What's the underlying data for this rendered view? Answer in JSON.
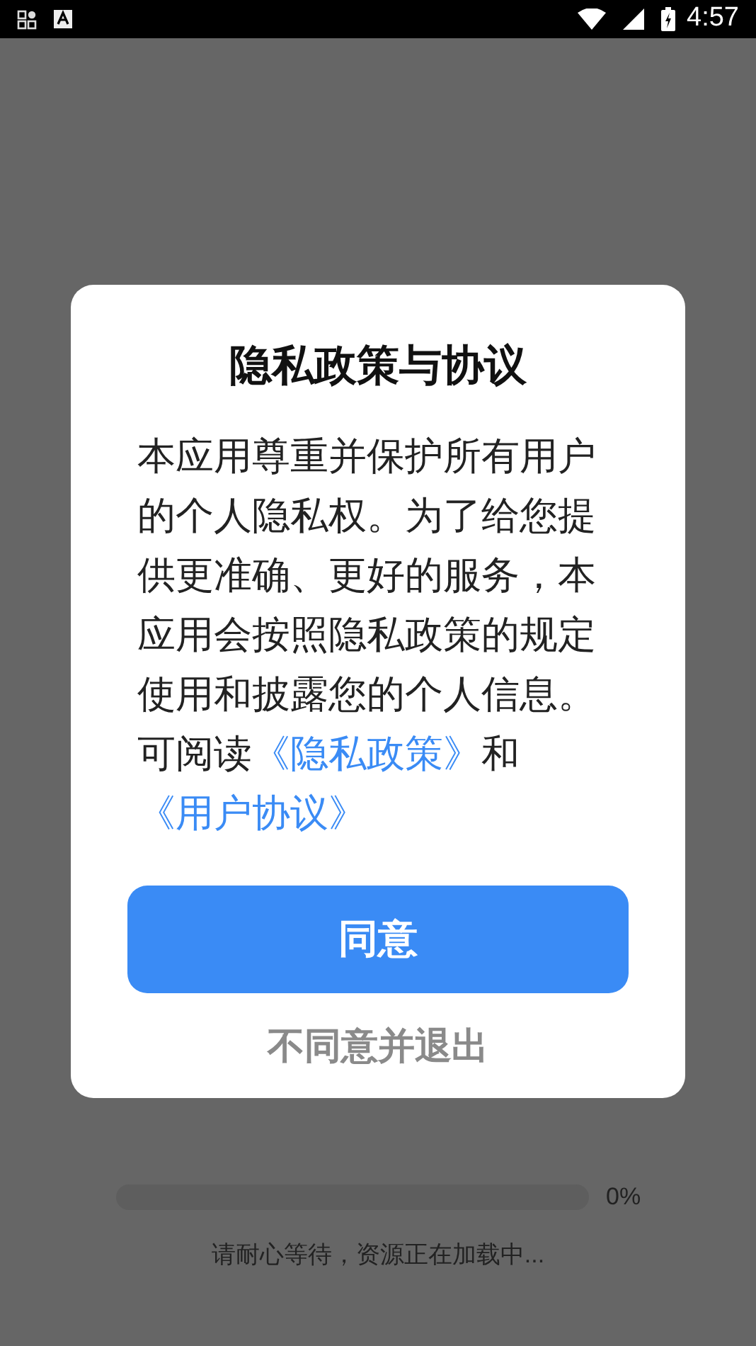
{
  "status_bar": {
    "time": "4:57"
  },
  "dialog": {
    "title": "隐私政策与协议",
    "body": "本应用尊重并保护所有用户的个人隐私权。为了给您提供更准确、更好的服务，本应用会按照隐私政策的规定使用和披露您的个人信息。",
    "links_sentence": [
      {
        "kind": "text",
        "text": "可阅读"
      },
      {
        "kind": "link",
        "text": "《隐私政策》"
      },
      {
        "kind": "text",
        "text": "和"
      },
      {
        "kind": "link",
        "text": "《用户协议》"
      }
    ],
    "agree_button": "同意",
    "decline_button": "不同意并退出"
  },
  "loading": {
    "level": 0,
    "reading": "0%",
    "message": "请耐心等待，资源正在加载中..."
  }
}
